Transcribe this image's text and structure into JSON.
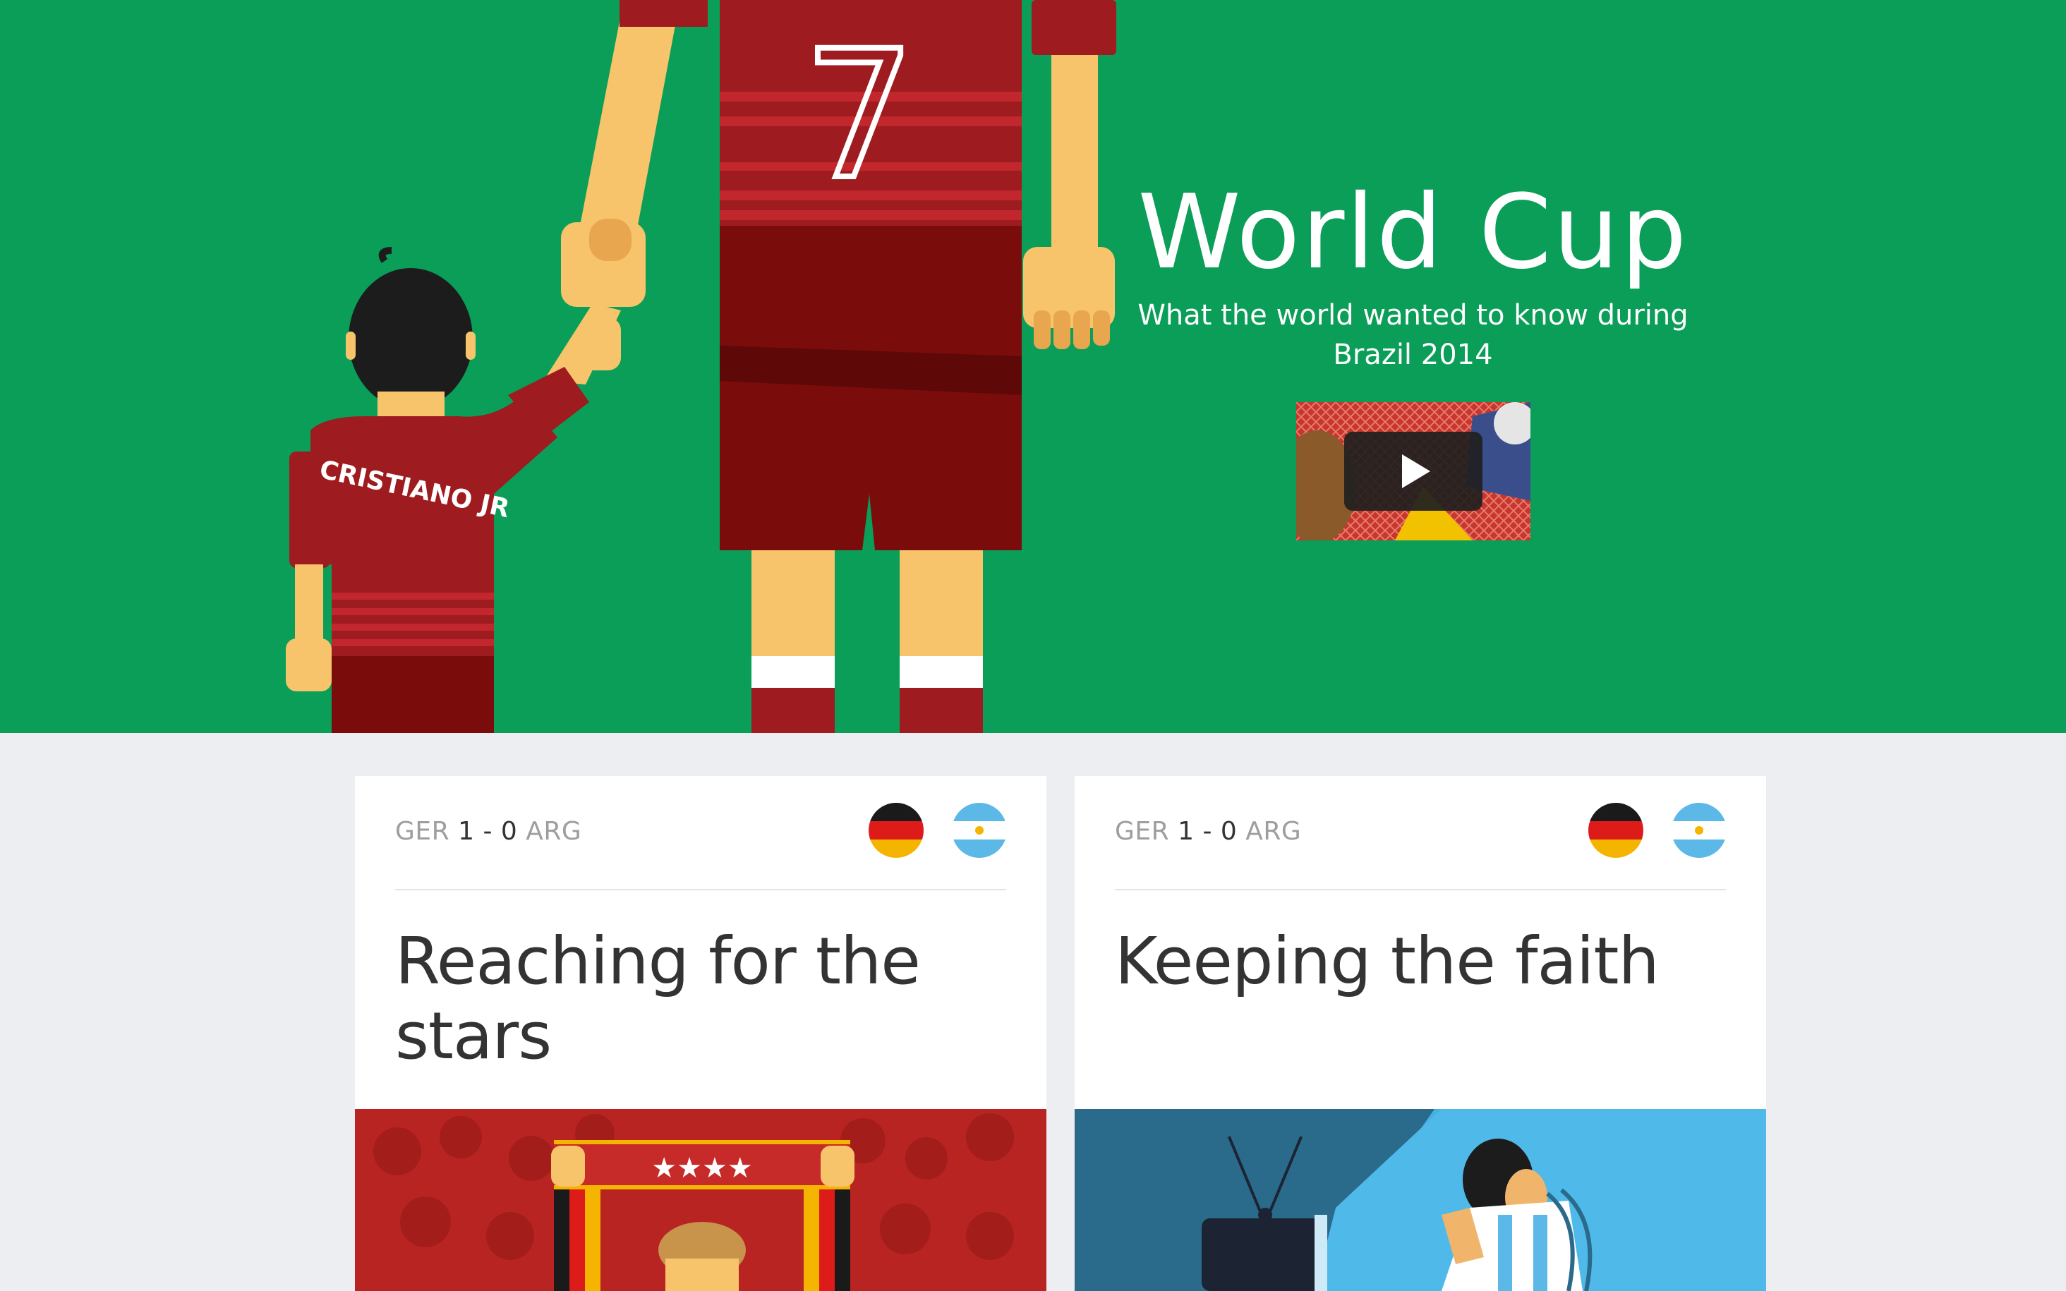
{
  "hero": {
    "title": "World Cup",
    "subtitle": "What the world wanted to know during Brazil 2014",
    "kid_jersey_text": "CRISTIANO JR",
    "player_number": "7",
    "video_thumbnail_icon": "play-icon",
    "colors": {
      "background": "#0a9e58",
      "jersey": "#9e1b1f",
      "jersey_dark": "#7a0c0c",
      "skin": "#f7c46c",
      "hair": "#1c1c1c"
    }
  },
  "cards": [
    {
      "score": {
        "team_a": "GER",
        "goals_a": "1",
        "separator": "-",
        "goals_b": "0",
        "team_b": "ARG"
      },
      "flags": [
        "germany-flag-icon",
        "argentina-flag-icon"
      ],
      "title": "Reaching for the stars",
      "scarf_stars": "★★★★",
      "art_background": "#b82421"
    },
    {
      "score": {
        "team_a": "GER",
        "goals_a": "1",
        "separator": "-",
        "goals_b": "0",
        "team_b": "ARG"
      },
      "flags": [
        "germany-flag-icon",
        "argentina-flag-icon"
      ],
      "title": "Keeping the faith",
      "art_background": "#45b0e2"
    }
  ],
  "page": {
    "background": "#eceef1"
  }
}
